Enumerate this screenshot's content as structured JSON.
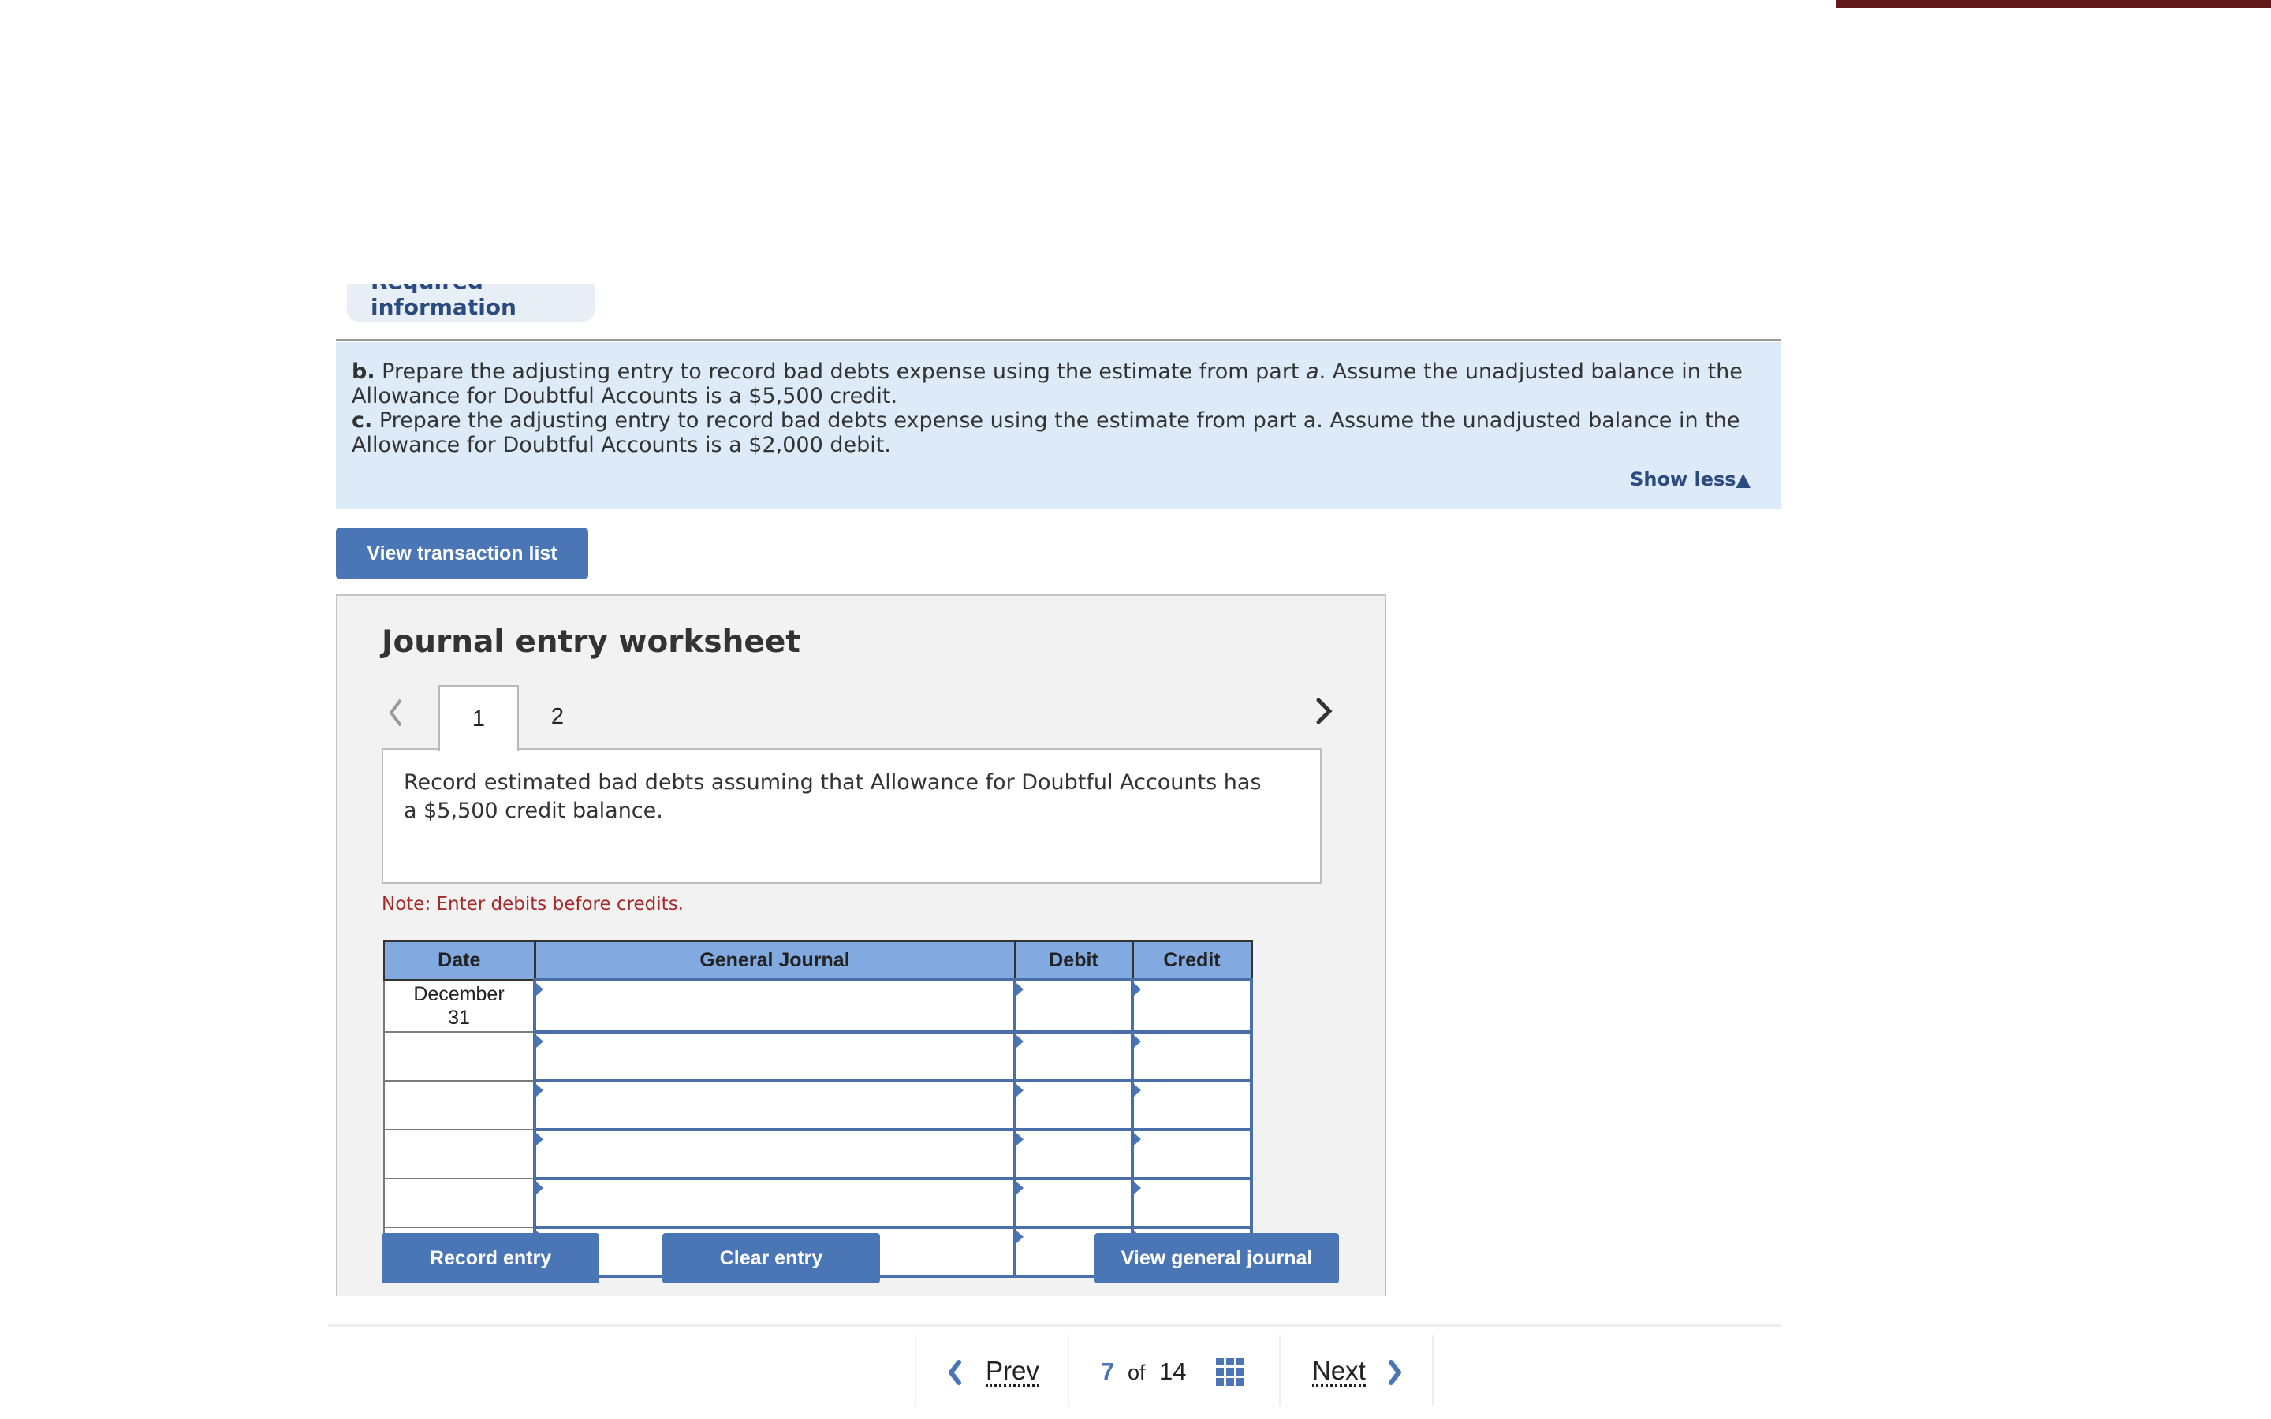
{
  "required_tab_label": "Required information",
  "prompt": {
    "b_label": "b.",
    "b_text_1": " Prepare the adjusting entry to record bad debts expense using the estimate from part ",
    "b_text_italic": "a",
    "b_text_2": ". Assume the unadjusted balance in the Allowance for Doubtful Accounts is a $5,500 credit.",
    "c_label": "c.",
    "c_text": " Prepare the adjusting entry to record bad debts expense using the estimate from part a. Assume the unadjusted balance in the Allowance for Doubtful Accounts is a $2,000 debit.",
    "show_less": "Show less▲"
  },
  "view_transaction_list": "View transaction list",
  "worksheet": {
    "title": "Journal entry worksheet",
    "tabs": [
      {
        "label": "1",
        "active": true
      },
      {
        "label": "2",
        "active": false
      }
    ],
    "description": "Record estimated bad debts assuming that Allowance for Doubtful Accounts has a $5,500 credit balance.",
    "note": "Note: Enter debits before credits.",
    "table": {
      "headers": [
        "Date",
        "General Journal",
        "Debit",
        "Credit"
      ],
      "rows": [
        {
          "date": "December 31",
          "account": "",
          "debit": "",
          "credit": ""
        },
        {
          "date": "",
          "account": "",
          "debit": "",
          "credit": ""
        },
        {
          "date": "",
          "account": "",
          "debit": "",
          "credit": ""
        },
        {
          "date": "",
          "account": "",
          "debit": "",
          "credit": ""
        },
        {
          "date": "",
          "account": "",
          "debit": "",
          "credit": ""
        },
        {
          "date": "",
          "account": "",
          "debit": "",
          "credit": ""
        }
      ]
    },
    "buttons": {
      "record": "Record entry",
      "clear": "Clear entry",
      "view_journal": "View general journal"
    }
  },
  "pager": {
    "prev": "Prev",
    "current": "7",
    "of": "of",
    "total": "14",
    "next": "Next"
  },
  "colors": {
    "accent": "#4a76b6",
    "header_bar": "#621a1a",
    "prompt_bg": "#ddebf8",
    "table_header": "#82aae0",
    "note": "#a52a2a"
  }
}
